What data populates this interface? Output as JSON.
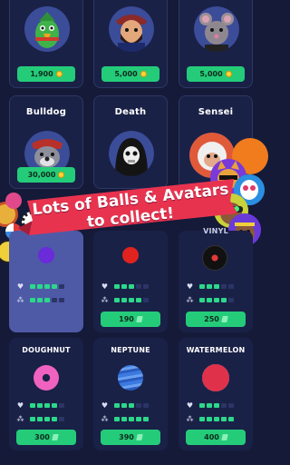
{
  "avatars_row": [
    {
      "name": "",
      "price": "1,900",
      "currency": "coin",
      "character": "parrot"
    },
    {
      "name": "",
      "price": "5,000",
      "currency": "coin",
      "character": "pirate"
    },
    {
      "name": "",
      "price": "5,000",
      "currency": "coin",
      "character": "rat"
    }
  ],
  "avatars_row2": [
    {
      "name": "Bulldog",
      "price": "30,000",
      "currency": "coin",
      "character": "bulldog"
    },
    {
      "name": "Death",
      "character": "skull-reaper"
    },
    {
      "name": "Sensei",
      "character": "sensei-monkey"
    }
  ],
  "banner": {
    "line1": "Lots of Balls & Avatars",
    "line2": "to collect!",
    "color": "#e8334f"
  },
  "balls_row": [
    {
      "name": "",
      "price": "",
      "life": 4,
      "power": 3,
      "color": "#6a2bd9",
      "selected": true
    },
    {
      "name": "",
      "price": "190",
      "life": 3,
      "power": 4,
      "color": "#e0231f"
    },
    {
      "name": "VINYL",
      "price": "250",
      "life": 3,
      "power": 4,
      "color": "#1a1a1a"
    }
  ],
  "balls_row3": [
    {
      "name": "DOUGHNUT",
      "price": "300",
      "life": 4,
      "power": 4,
      "color": "#f062c0"
    },
    {
      "name": "NEPTUNE",
      "price": "390",
      "life": 3,
      "power": 5,
      "color": "#3b7ae0"
    },
    {
      "name": "WATERMELON",
      "price": "400",
      "life": 3,
      "power": 5,
      "color": "#e0314a"
    }
  ],
  "icons": {
    "life": "heart-icon",
    "power": "cluster-icon"
  },
  "colors": {
    "background": "#141a38",
    "card": "#1a2147",
    "price": "#24cc7a",
    "selected": "#4e5aa6"
  }
}
